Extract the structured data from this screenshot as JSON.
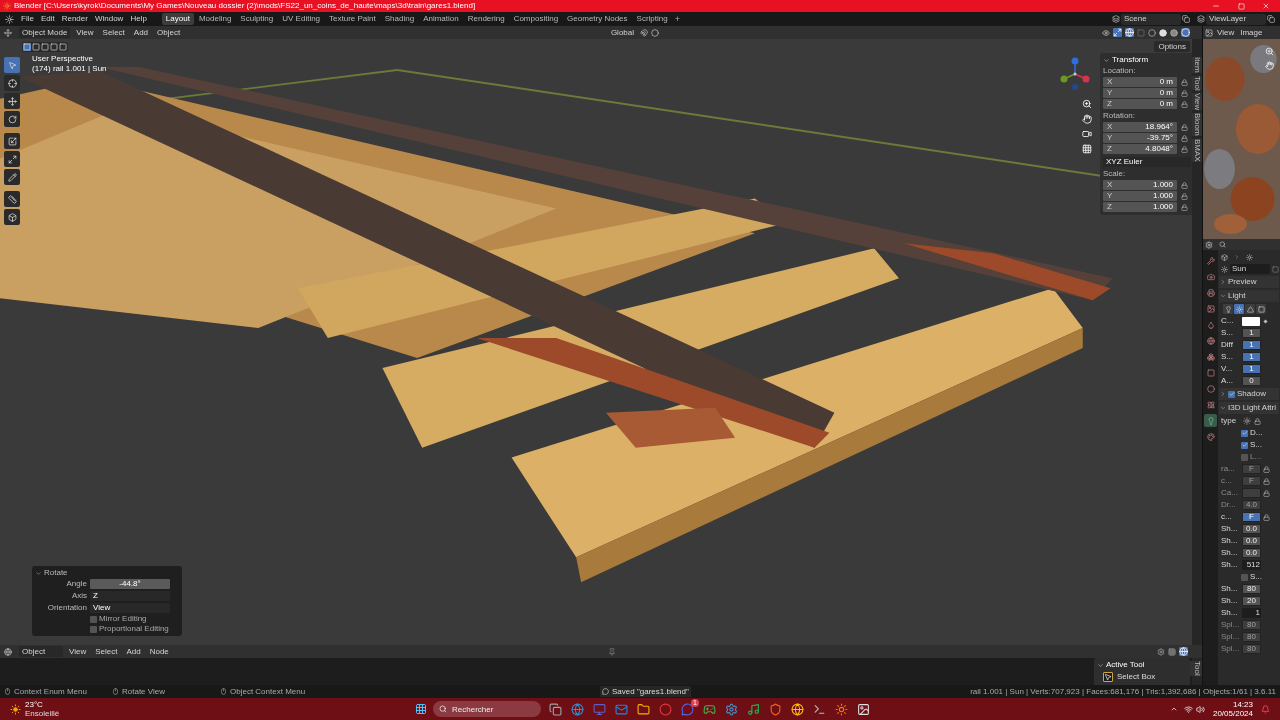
{
  "window": {
    "title": "Blender [C:\\Users\\kyrok\\Documents\\My Games\\Nouveau dossier (2)\\mods\\FS22_un_coins_de_haute\\maps\\3d\\train\\gares1.blend]"
  },
  "menu": [
    "File",
    "Edit",
    "Render",
    "Window",
    "Help"
  ],
  "workspaces": [
    {
      "label": "Layout",
      "selected": true
    },
    {
      "label": "Modeling",
      "selected": false
    },
    {
      "label": "Sculpting",
      "selected": false
    },
    {
      "label": "UV Editing",
      "selected": false
    },
    {
      "label": "Texture Paint",
      "selected": false
    },
    {
      "label": "Shading",
      "selected": false
    },
    {
      "label": "Animation",
      "selected": false
    },
    {
      "label": "Rendering",
      "selected": false
    },
    {
      "label": "Compositing",
      "selected": false
    },
    {
      "label": "Geometry Nodes",
      "selected": false
    },
    {
      "label": "Scripting",
      "selected": false
    }
  ],
  "add_workspace": "+",
  "scene": "Scene",
  "view_layer": "ViewLayer",
  "viewport": {
    "mode": "Object Mode",
    "menus": [
      "View",
      "Select",
      "Add",
      "Object"
    ],
    "orientation": "Global",
    "options": "Options",
    "view_name": "User Perspective",
    "object_info": "(174) rail 1.001 | Sun",
    "tools": [
      {
        "selected": true
      },
      {
        "selected": false
      },
      {
        "selected": false
      },
      {
        "selected": false
      },
      {
        "selected": false
      },
      {
        "selected": false
      },
      {
        "selected": false
      },
      {
        "selected": false
      },
      {
        "selected": false
      }
    ]
  },
  "transform": {
    "title": "Transform",
    "groups": [
      {
        "label": "Location:",
        "rows": [
          {
            "axis": "X",
            "value": "0 m"
          },
          {
            "axis": "Y",
            "value": "0 m"
          },
          {
            "axis": "Z",
            "value": "0 m"
          }
        ]
      },
      {
        "label": "Rotation:",
        "rows": [
          {
            "axis": "X",
            "value": "18.964°"
          },
          {
            "axis": "Y",
            "value": "-39.75°"
          },
          {
            "axis": "Z",
            "value": "4.8048°"
          }
        ],
        "mode": "XYZ Euler"
      },
      {
        "label": "Scale:",
        "rows": [
          {
            "axis": "X",
            "value": "1.000"
          },
          {
            "axis": "Y",
            "value": "1.000"
          },
          {
            "axis": "Z",
            "value": "1.000"
          }
        ]
      }
    ]
  },
  "side_tabs": [
    "Item",
    "Tool",
    "View",
    "Bloom",
    "BMAX"
  ],
  "operator_panel": {
    "title": "Rotate",
    "fields": [
      {
        "label": "Angle",
        "value": "-44.8°",
        "kind": "number"
      },
      {
        "label": "Axis",
        "value": "Z",
        "kind": "dropdown"
      },
      {
        "label": "Orientation",
        "value": "View",
        "kind": "dropdown"
      }
    ],
    "checks": [
      {
        "label": "Mirror Editing",
        "checked": false
      },
      {
        "label": "Proportional Editing",
        "checked": false
      }
    ]
  },
  "image_editor": {
    "menus": [
      "View",
      "Image"
    ]
  },
  "properties": {
    "tabs": [
      {
        "selected": false
      },
      {
        "selected": false
      },
      {
        "selected": false
      },
      {
        "selected": false
      },
      {
        "selected": false
      },
      {
        "selected": false
      },
      {
        "selected": false
      },
      {
        "selected": false
      },
      {
        "selected": false
      },
      {
        "selected": false
      },
      {
        "selected": true
      },
      {
        "selected": false
      }
    ],
    "object_name": "Sun",
    "rows": [
      {
        "kind": "section",
        "label": "Preview",
        "expanded": false
      },
      {
        "kind": "section",
        "label": "Light",
        "expanded": true
      },
      {
        "kind": "light_types",
        "items": [
          {
            "selected": false
          },
          {
            "selected": true
          },
          {
            "selected": false
          },
          {
            "selected": false
          }
        ]
      },
      {
        "kind": "color",
        "label": "C..."
      },
      {
        "kind": "field",
        "label": "S...",
        "value": "1",
        "highlighted": false
      },
      {
        "kind": "field",
        "label": "Diff",
        "value": "1",
        "highlighted": true
      },
      {
        "kind": "field",
        "label": "S...",
        "value": "1",
        "highlighted": true
      },
      {
        "kind": "field",
        "label": "V...",
        "value": "1",
        "highlighted": true
      },
      {
        "kind": "field",
        "label": "A...",
        "value": "0",
        "highlighted": false
      },
      {
        "kind": "section",
        "label": "Shadow",
        "expanded": false,
        "checked": true
      },
      {
        "kind": "section",
        "label": "I3D Light Attri",
        "expanded": true
      },
      {
        "kind": "type",
        "label": "type"
      },
      {
        "kind": "check",
        "label": "D...",
        "checked": true,
        "disabled": false
      },
      {
        "kind": "check",
        "label": "S...",
        "checked": true,
        "disabled": false
      },
      {
        "kind": "check",
        "label": "L...",
        "checked": false,
        "disabled": true
      },
      {
        "kind": "field",
        "label": "ra...",
        "value": "F",
        "disabled": true,
        "lock": true
      },
      {
        "kind": "field",
        "label": "c...",
        "value": "F",
        "disabled": true,
        "lock": true
      },
      {
        "kind": "field",
        "label": "Ca...",
        "disabled": true,
        "lock": true
      },
      {
        "kind": "field",
        "label": "Dr...",
        "value": "4.0",
        "disabled": true
      },
      {
        "kind": "field",
        "label": "c...",
        "value": "F",
        "highlighted": true,
        "lock": true
      },
      {
        "kind": "field",
        "label": "Sh...",
        "value": "0.0"
      },
      {
        "kind": "field",
        "label": "Sh...",
        "value": "0.0"
      },
      {
        "kind": "field",
        "label": "Sh...",
        "value": "0.0"
      },
      {
        "kind": "dropdown",
        "label": "Sh...",
        "value": "512"
      },
      {
        "kind": "check",
        "label": "S...",
        "checked": false,
        "disabled": false
      },
      {
        "kind": "field",
        "label": "Sh...",
        "value": "80"
      },
      {
        "kind": "field",
        "label": "Sh...",
        "value": "20"
      },
      {
        "kind": "dropdown",
        "label": "Sh...",
        "value": "1"
      },
      {
        "kind": "field",
        "label": "Spl...",
        "value": "80",
        "disabled": true
      },
      {
        "kind": "field",
        "label": "Spl...",
        "value": "80",
        "disabled": true
      },
      {
        "kind": "field",
        "label": "Spl...",
        "value": "80",
        "disabled": true
      }
    ]
  },
  "node_editor": {
    "type": "Object",
    "menus": [
      "View",
      "Select",
      "Add",
      "Node"
    ],
    "tool_tab": "Tool",
    "active_tool": {
      "title": "Active Tool",
      "tool": "Select Box"
    }
  },
  "status_bar": {
    "hints": [
      "Context Enum Menu",
      "Rotate View",
      "Object Context Menu"
    ],
    "saved": "Saved \"gares1.blend\"",
    "stats": "rail 1.001 | Sun | Verts:707,923 | Faces:681,176 | Tris:1,392,686 | Objects:1/61 | 3.6.11"
  },
  "taskbar": {
    "temperature": "23°C",
    "weather": "Ensoleillé",
    "search": {
      "placeholder": "Rechercher"
    },
    "badge": "1",
    "time": "14:23",
    "date": "20/05/2024"
  }
}
